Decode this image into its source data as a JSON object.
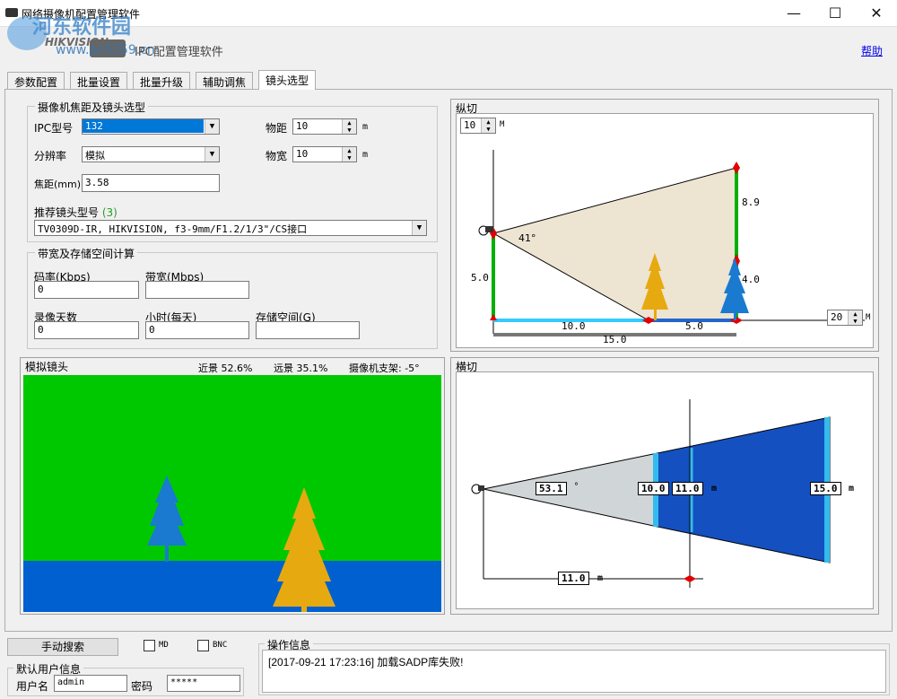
{
  "window": {
    "title": "网络摄像机配置管理软件",
    "minimize": "—",
    "maximize": "☐",
    "close": "✕"
  },
  "header": {
    "watermark_name": "河东软件园",
    "watermark_url": "www.pc0359.cn",
    "brand": "HIKVISION",
    "app_name": "IPC配置管理软件",
    "help": "帮助"
  },
  "tabs": [
    {
      "label": "参数配置",
      "active": false
    },
    {
      "label": "批量设置",
      "active": false
    },
    {
      "label": "批量升级",
      "active": false
    },
    {
      "label": "辅助调焦",
      "active": false
    },
    {
      "label": "镜头选型",
      "active": true
    }
  ],
  "focus_group": {
    "title": "摄像机焦距及镜头选型",
    "ipc_model_label": "IPC型号",
    "ipc_model_value": "132",
    "distance_label": "物距",
    "distance_value": "10",
    "distance_unit": "m",
    "resolution_label": "分辨率",
    "resolution_value": "模拟",
    "width_label": "物宽",
    "width_value": "10",
    "width_unit": "m",
    "focal_label": "焦距(mm)",
    "focal_value": "3.58",
    "recommend_label": "推荐镜头型号",
    "recommend_count": "(3)",
    "recommend_value": "TV0309D-IR, HIKVISION, f3-9mm/F1.2/1/3\"/CS接口"
  },
  "bandwidth_group": {
    "title": "带宽及存储空间计算",
    "bitrate_label": "码率(Kbps)",
    "bitrate_value": "0",
    "bandwidth_label": "带宽(Mbps)",
    "bandwidth_value": "",
    "days_label": "录像天数",
    "days_value": "0",
    "hours_label": "小时(每天)",
    "hours_value": "0",
    "storage_label": "存储空间(G)",
    "storage_value": ""
  },
  "sim_panel": {
    "title": "模拟镜头",
    "near": "近景 52.6%",
    "far": "远景 35.1%",
    "mount": "摄像机支架: -5°",
    "colors": {
      "grass": "#00c800",
      "ground": "#0060d0",
      "tree_blue": "#1a7ad0",
      "tree_gold": "#e6aa10"
    }
  },
  "vertical_panel": {
    "title": "纵切",
    "scale_top": "10",
    "scale_top_unit": "M",
    "scale_bottom": "20",
    "scale_bottom_unit": "M",
    "angle": "41°",
    "height_cam": "5.0",
    "height_far": "8.9",
    "height_tree": "4.0",
    "dist_near": "10.0",
    "dist_span": "5.0",
    "dist_total": "15.0"
  },
  "horizontal_panel": {
    "title": "横切",
    "angle": "53.1",
    "angle_unit": "°",
    "w1": "10.0",
    "w2": "11.0",
    "w_unit": "m",
    "w3": "15.0",
    "w3_unit": "m",
    "dist": "11.0",
    "dist_unit": "m"
  },
  "bottom": {
    "search_button": "手动搜索",
    "md_label": "MD",
    "bnc_label": "BNC",
    "user_group": "默认用户信息",
    "user_label": "用户名",
    "user_value": "admin",
    "pass_label": "密码",
    "pass_value": "*****",
    "log_title": "操作信息",
    "log_line": "[2017-09-21 17:23:16] 加载SADP库失败!"
  }
}
